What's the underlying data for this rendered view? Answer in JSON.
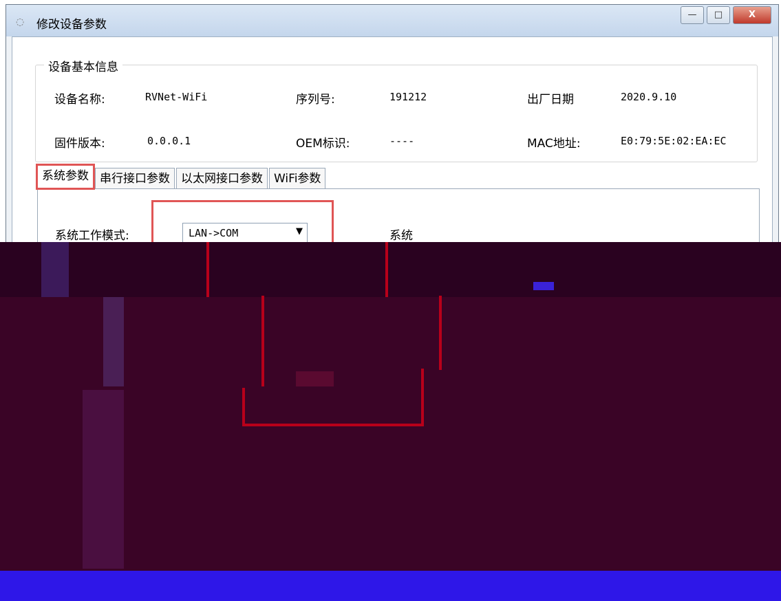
{
  "window": {
    "title": "修改设备参数",
    "buttons": {
      "minimize": "—",
      "maximize": "□",
      "close": "X"
    }
  },
  "basic_info": {
    "legend": "设备基本信息",
    "device_name_label": "设备名称:",
    "device_name": "RVNet-WiFi",
    "serial_label": "序列号:",
    "serial": "191212",
    "date_label": "出厂日期",
    "date": "2020.9.10",
    "firmware_label": "固件版本:",
    "firmware": "0.0.0.1",
    "oem_label": "OEM标识:",
    "oem": "----",
    "mac_label": "MAC地址:",
    "mac": "E0:79:5E:02:EA:EC"
  },
  "tabs": [
    {
      "label": "系统参数"
    },
    {
      "label": "串行接口参数"
    },
    {
      "label": "以太网接口参数"
    },
    {
      "label": "WiFi参数"
    }
  ],
  "system": {
    "mode_label": "系统工作模式:",
    "mode_value": "LAN->COM",
    "right_label": "系统"
  },
  "colors": {
    "highlight": "#e05555",
    "glitch_bg": "#3a0426",
    "blue_bar": "#2e17e8"
  }
}
